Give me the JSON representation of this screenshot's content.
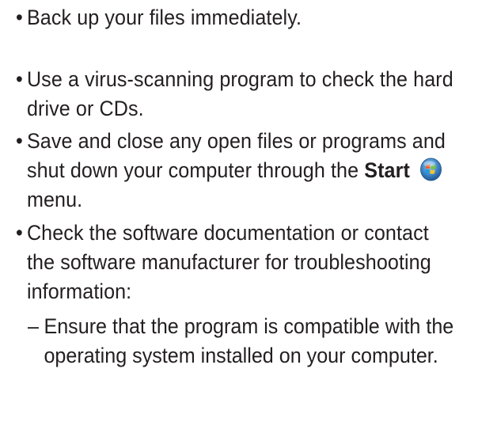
{
  "bullets": [
    {
      "text": "Back up your files immediately."
    },
    {
      "text": "Use a virus-scanning program to check the hard drive or CDs."
    },
    {
      "text_before": "Save and close any open files or programs and shut down your computer through the",
      "bold_word": "Start",
      "icon": "windows-start-orb-icon",
      "text_after": "menu."
    },
    {
      "text": "Check the software documentation or contact the software manufacturer for troubleshooting information:"
    }
  ],
  "sub_items": [
    {
      "text": "Ensure that the program is compatible with the operating system installed on your computer."
    }
  ],
  "symbols": {
    "bullet": "•",
    "dash": "–"
  }
}
